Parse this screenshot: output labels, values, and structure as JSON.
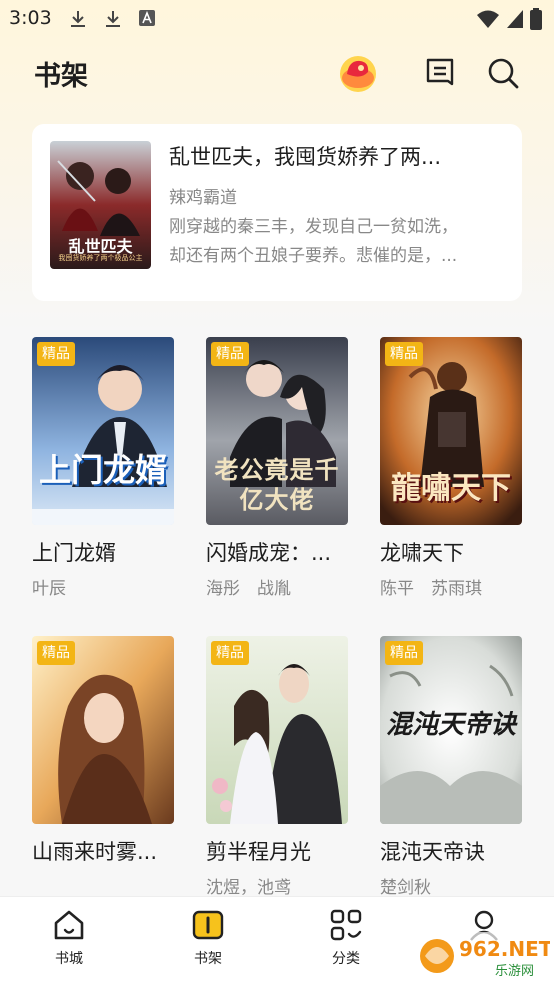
{
  "status_bar": {
    "time": "3:03"
  },
  "header": {
    "title": "书架"
  },
  "featured": {
    "title": "乱世匹夫，我囤货娇养了两...",
    "author": "辣鸡霸道",
    "desc_line1": "刚穿越的秦三丰，发现自己一贫如洗，",
    "desc_line2": "却还有两个丑娘子要养。悲催的是，...",
    "cover_title": "乱世匹夫",
    "cover_subtitle": "我囤货娇养了两个极品公主"
  },
  "books": [
    {
      "badge": "精品",
      "title": "上门龙婿",
      "author": "叶辰",
      "cover_text": "上门龙婿"
    },
    {
      "badge": "精品",
      "title": "闪婚成宠：...",
      "author": "海彤　战胤",
      "cover_text": "老公竟是千亿大佬"
    },
    {
      "badge": "精品",
      "title": "龙啸天下",
      "author": "陈平　苏雨琪",
      "cover_text": "龍嘯天下"
    },
    {
      "badge": "精品",
      "title": "山雨来时雾...",
      "author": "",
      "cover_text": ""
    },
    {
      "badge": "精品",
      "title": "剪半程月光",
      "author": "沈煜，池鸢",
      "cover_text": ""
    },
    {
      "badge": "精品",
      "title": "混沌天帝诀",
      "author": "楚剑秋",
      "cover_text": "混沌天帝诀"
    }
  ],
  "nav": [
    {
      "label": "书城",
      "icon": "home-icon"
    },
    {
      "label": "书架",
      "icon": "bookshelf-icon"
    },
    {
      "label": "分类",
      "icon": "category-icon"
    },
    {
      "label": "",
      "icon": "profile-icon"
    }
  ],
  "watermark": {
    "text": "962.NET",
    "subtext": "乐游网"
  },
  "colors": {
    "accent": "#f3b515",
    "background": "#f7f7f7",
    "muted_text": "#888888"
  }
}
